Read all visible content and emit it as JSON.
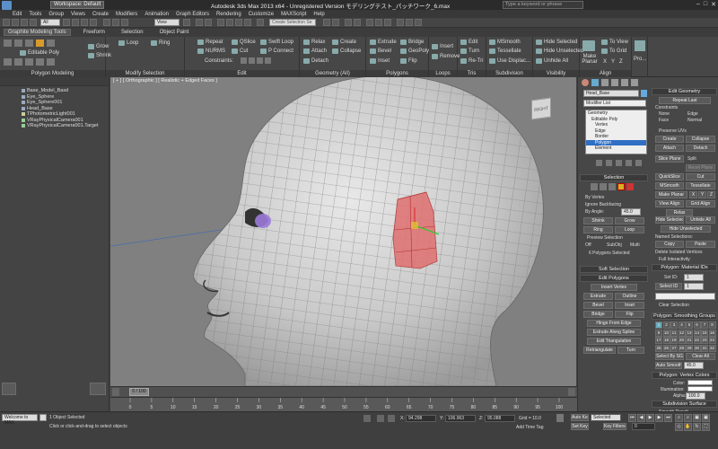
{
  "titlebar": {
    "workspace": "Workspace: Default",
    "title": "Autodesk 3ds Max  2013 x64  -  Unregistered Version    モデリングテスト_パッチワーク_6.max",
    "search_placeholder": "Type a keyword or phrase"
  },
  "menu": [
    "Edit",
    "Tools",
    "Group",
    "Views",
    "Create",
    "Modifiers",
    "Animation",
    "Graph Editors",
    "Rendering",
    "Customize",
    "MAXScript",
    "Help"
  ],
  "toolbar": {
    "selection_filter": "All",
    "ref_coord": "View",
    "named_sel_placeholder": "Create Selection Se"
  },
  "ribbon_tabs": [
    "Graphite Modeling Tools",
    "Freeform",
    "Selection",
    "Object Paint"
  ],
  "ribbon": {
    "polymodel": {
      "label": "Editable Poly",
      "group": "Polygon Modeling"
    },
    "modify_sel": {
      "group": "Modify Selection",
      "items": [
        "Grow",
        "Shrink",
        "Loop",
        "Ring"
      ]
    },
    "edit": {
      "group": "Edit",
      "items": [
        "Repeat",
        "NURMS",
        "Constraints:",
        "QSlice",
        "Cut",
        "Swift Loop",
        "P Connect"
      ]
    },
    "geometry": {
      "group": "Geometry (All)",
      "items": [
        "Relax",
        "Attach",
        "Detach",
        "Create",
        "Collapse"
      ]
    },
    "polygons": {
      "group": "Polygons",
      "items": [
        "Extrude",
        "Bevel",
        "Inset",
        "Bridge",
        "GeoPoly",
        "Flip"
      ]
    },
    "loops": {
      "group": "Loops",
      "items": [
        "Insert",
        "Remove"
      ]
    },
    "tris": {
      "group": "Tris",
      "items": [
        "Edit",
        "Turn",
        "Re-Tri"
      ]
    },
    "subdivision": {
      "group": "Subdivision",
      "items": [
        "MSmooth",
        "Tessellate",
        "Use Displac..."
      ]
    },
    "visibility": {
      "group": "Visibility",
      "items": [
        "Hide Selected",
        "Hide Unselected",
        "Unhide All"
      ]
    },
    "align": {
      "group": "Align",
      "items": [
        "Make Planar",
        "To View",
        "To Grid",
        "X",
        "Y",
        "Z"
      ]
    },
    "pro": {
      "label": "Pro..."
    }
  },
  "scene_explorer": [
    {
      "name": "Base_Model_Basd"
    },
    {
      "name": "Eye_Sphere"
    },
    {
      "name": "Eye_Sphere001"
    },
    {
      "name": "Head_Base"
    },
    {
      "name": "TPhotometricLight001"
    },
    {
      "name": "VRayPhysicalCamera001"
    },
    {
      "name": "VRayPhysicalCamera001.Target"
    }
  ],
  "viewport": {
    "label": "[ + ] [ Orthographic ] [ Realistic + Edged Faces ]",
    "viewcube": "RIGHT"
  },
  "cmd": {
    "object_name": "Head_Base",
    "modifier_list": "Modifier List",
    "stack": [
      "Geometry",
      "Editable Poly",
      "Vertex",
      "Edge",
      "Border",
      "Polygon",
      "Element"
    ],
    "stack_selected": 5,
    "selection": {
      "title": "Selection",
      "by_vertex": "By Vertex",
      "ignore_bf": "Ignore Backfacing",
      "by_angle": "By Angle:",
      "angle": "45.0",
      "shrink": "Shrink",
      "grow": "Grow",
      "ring": "Ring",
      "loop": "Loop",
      "preview": "Preview Selection",
      "off": "Off",
      "subobj": "SubObj",
      "multi": "Multi",
      "status": "6 Polygons Selected"
    },
    "soft_sel": "Soft Selection",
    "edit_polys": {
      "title": "Edit Polygons",
      "insert_vertex": "Insert Vertex",
      "extrude": "Extrude",
      "outline": "Outline",
      "bevel": "Bevel",
      "inset": "Inset",
      "bridge": "Bridge",
      "flip": "Flip",
      "hinge": "Hinge From Edge",
      "extrude_spline": "Extrude Along Spline",
      "edit_tri": "Edit Triangulation",
      "retriangulate": "Retriangulate",
      "turn": "Turn"
    },
    "edit_geom": {
      "title": "Edit Geometry",
      "repeat_last": "Repeat Last",
      "constraints": "Constraints",
      "none": "None",
      "edge": "Edge",
      "face": "Face",
      "normal": "Normal",
      "preserve_uvs": "Preserve UVs",
      "create": "Create",
      "collapse": "Collapse",
      "attach": "Attach",
      "detach": "Detach",
      "slice_plane": "Slice Plane",
      "split": "Split",
      "reset_plane": "Reset Plane",
      "quickslice": "QuickSlice",
      "cut": "Cut",
      "msmooth": "MSmooth",
      "tessellate": "Tessellate",
      "make_planar": "Make Planar",
      "x": "X",
      "y": "Y",
      "z": "Z",
      "view_align": "View Align",
      "grid_align": "Grid Align",
      "relax": "Relax",
      "hide_sel": "Hide Selected",
      "unhide_all": "Unhide All",
      "hide_unsel": "Hide Unselected",
      "named_sel": "Named Selections:",
      "copy": "Copy",
      "paste": "Paste",
      "delete_iso": "Delete Isolated Vertices",
      "full_inter": "Full Interactivity"
    },
    "mat_ids": {
      "title": "Polygon: Material IDs",
      "set_id": "Set ID:",
      "set_id_val": "1",
      "select_id": "Select ID",
      "select_id_val": "1",
      "clear_sel": "Clear Selection"
    },
    "smoothing": {
      "title": "Polygon: Smoothing Groups",
      "groups": [
        "1",
        "2",
        "3",
        "4",
        "5",
        "6",
        "7",
        "8",
        "9",
        "10",
        "11",
        "12",
        "13",
        "14",
        "15",
        "16",
        "17",
        "18",
        "19",
        "20",
        "21",
        "22",
        "23",
        "24",
        "25",
        "26",
        "27",
        "28",
        "29",
        "30",
        "31",
        "32"
      ],
      "select_by_sg": "Select By SG",
      "clear_all": "Clear All",
      "auto_smooth": "Auto Smooth",
      "auto_val": "45.0"
    },
    "vertex_colors": {
      "title": "Polygon: Vertex Colors",
      "color": "Color:",
      "illum": "Illumination:",
      "alpha": "Alpha:",
      "alpha_val": "100.0"
    },
    "subdiv": {
      "title": "Subdivision Surface",
      "smooth_result": "Smooth Result"
    }
  },
  "timeline": {
    "frame": "0 / 100"
  },
  "ruler_ticks": [
    "0",
    "5",
    "10",
    "15",
    "20",
    "25",
    "30",
    "35",
    "40",
    "45",
    "50",
    "55",
    "60",
    "65",
    "70",
    "75",
    "80",
    "85",
    "90",
    "95",
    "100"
  ],
  "status": {
    "maxscript": "Welcome to MAX",
    "selected": "1 Object Selected",
    "prompt": "Click or click-and-drag to select objects",
    "x": "94.298",
    "y": "106.963",
    "z": "95.088",
    "grid": "Grid = 10.0",
    "autokey": "Auto Key",
    "selected_mode": "Selected",
    "set_key": "Set Key",
    "key_filters": "Key Filters...",
    "add_time_tag": "Add Time Tag",
    "frame": "0"
  }
}
